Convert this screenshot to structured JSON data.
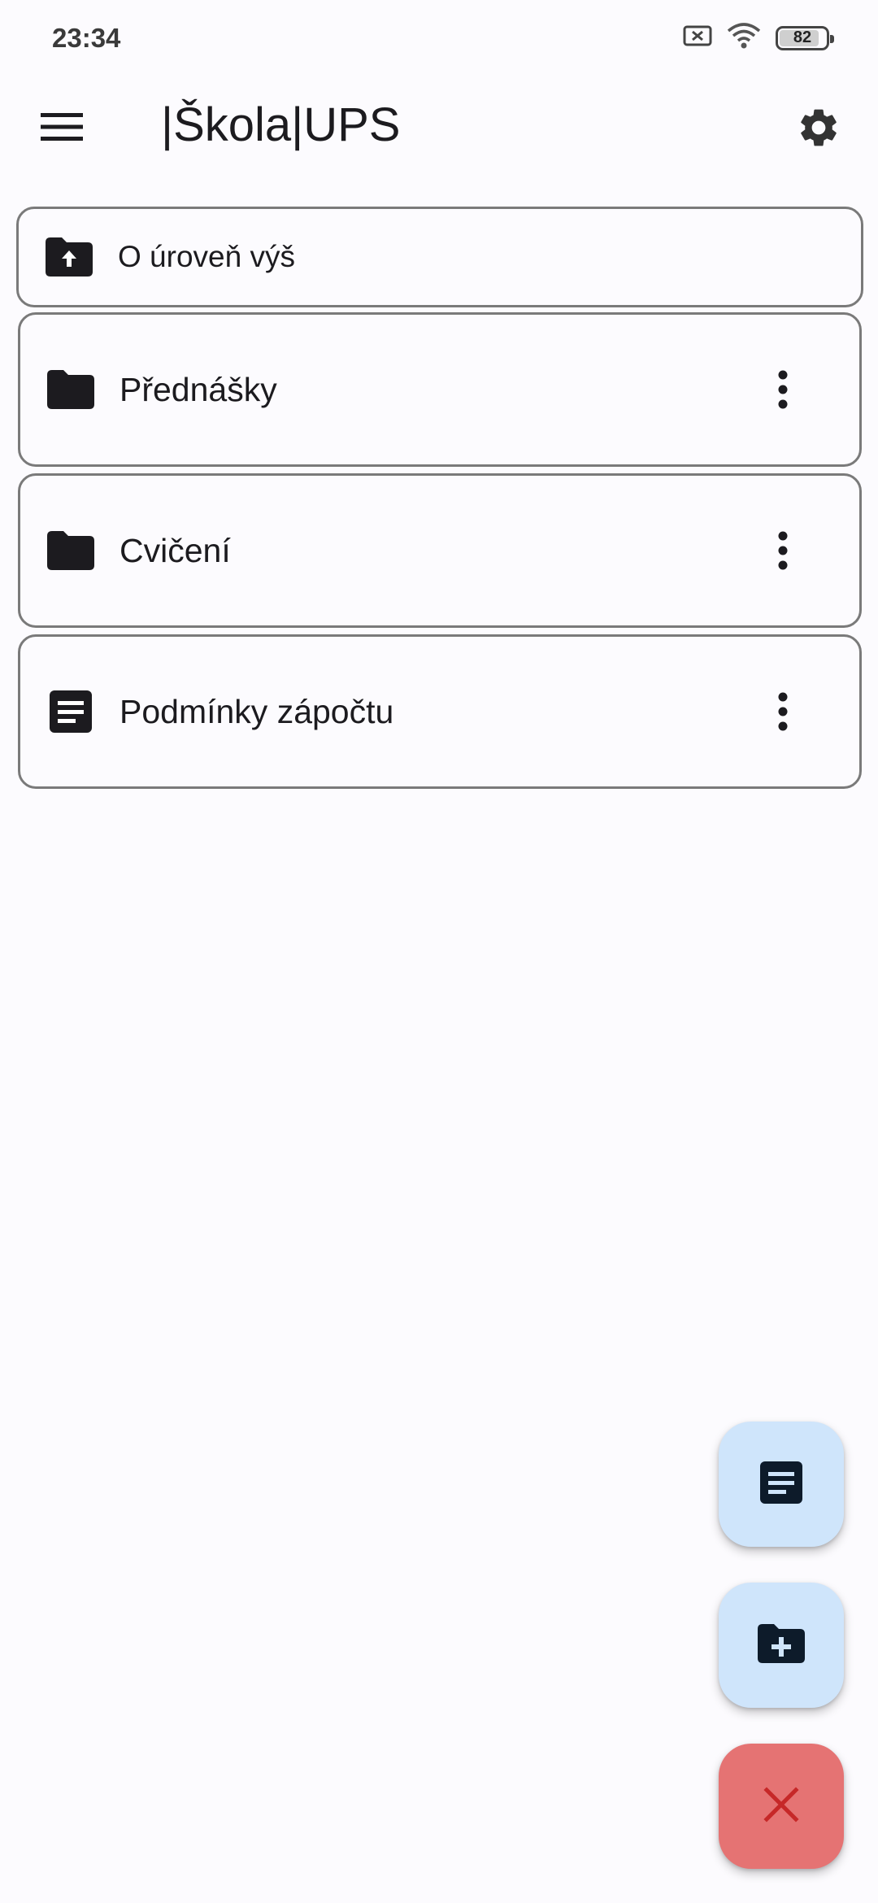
{
  "status_bar": {
    "time": "23:34",
    "battery_level": "82",
    "icons": [
      "no-sim-icon",
      "wifi-icon",
      "battery-icon"
    ]
  },
  "app_bar": {
    "title": "|Škola|UPS",
    "menu_icon": "menu-icon",
    "settings_icon": "gear-icon"
  },
  "list": {
    "up_item": {
      "label": "O úroveň výš",
      "icon": "folder-up-icon"
    },
    "items": [
      {
        "label": "Přednášky",
        "icon": "folder-icon",
        "type": "folder"
      },
      {
        "label": "Cvičení",
        "icon": "folder-icon",
        "type": "folder"
      },
      {
        "label": "Podmínky zápočtu",
        "icon": "document-icon",
        "type": "document"
      }
    ]
  },
  "fabs": {
    "new_document": {
      "icon": "document-icon",
      "color": "#cfe5fb"
    },
    "new_folder": {
      "icon": "folder-plus-icon",
      "color": "#cfe5fb"
    },
    "close": {
      "icon": "close-icon",
      "color": "#e57373"
    }
  },
  "colors": {
    "background": "#fcfbfe",
    "border": "#7a7a7a",
    "fab_light": "#cfe5fb",
    "fab_red": "#e57373",
    "close_x": "#c62828"
  }
}
